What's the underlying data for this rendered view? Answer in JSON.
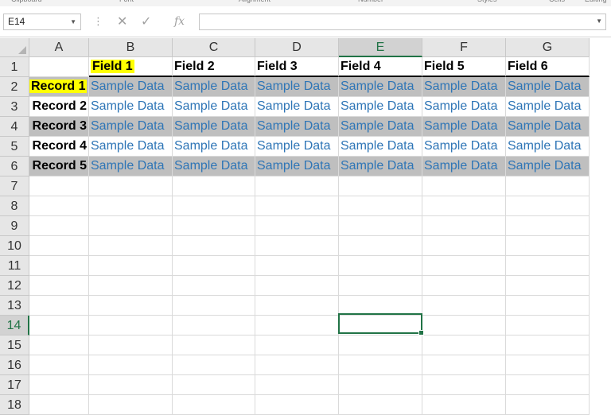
{
  "ribbon_groups": [
    "Clipboard",
    "Font",
    "Alignment",
    "Number",
    "Styles",
    "Cells",
    "Editing"
  ],
  "name_box": {
    "value": "E14"
  },
  "formula_bar": {
    "cancel_icon": "cancel-icon",
    "enter_icon": "check-icon",
    "fx_label": "fx",
    "value": ""
  },
  "columns": [
    "A",
    "B",
    "C",
    "D",
    "E",
    "F",
    "G"
  ],
  "selected_column": "E",
  "rows": [
    "1",
    "2",
    "3",
    "4",
    "5",
    "6",
    "7",
    "8",
    "9",
    "10",
    "11",
    "12",
    "13",
    "14",
    "15",
    "16",
    "17",
    "18"
  ],
  "selected_row": "14",
  "active_cell": "E14",
  "header_row": [
    "",
    "Field 1",
    "Field 2",
    "Field 3",
    "Field 4",
    "Field 5",
    "Field 6"
  ],
  "records": [
    {
      "name": "Record 1",
      "values": [
        "Sample Data",
        "Sample Data",
        "Sample Data",
        "Sample Data",
        "Sample Data",
        "Sample Data"
      ]
    },
    {
      "name": "Record 2",
      "values": [
        "Sample Data",
        "Sample Data",
        "Sample Data",
        "Sample Data",
        "Sample Data",
        "Sample Data"
      ]
    },
    {
      "name": "Record 3",
      "values": [
        "Sample Data",
        "Sample Data",
        "Sample Data",
        "Sample Data",
        "Sample Data",
        "Sample Data"
      ]
    },
    {
      "name": "Record 4",
      "values": [
        "Sample Data",
        "Sample Data",
        "Sample Data",
        "Sample Data",
        "Sample Data",
        "Sample Data"
      ]
    },
    {
      "name": "Record 5",
      "values": [
        "Sample Data",
        "Sample Data",
        "Sample Data",
        "Sample Data",
        "Sample Data",
        "Sample Data"
      ]
    }
  ],
  "colors": {
    "accent": "#217346",
    "data_text": "#2e75b6",
    "banding": "#bfbfbf",
    "highlight": "#ffff00"
  }
}
